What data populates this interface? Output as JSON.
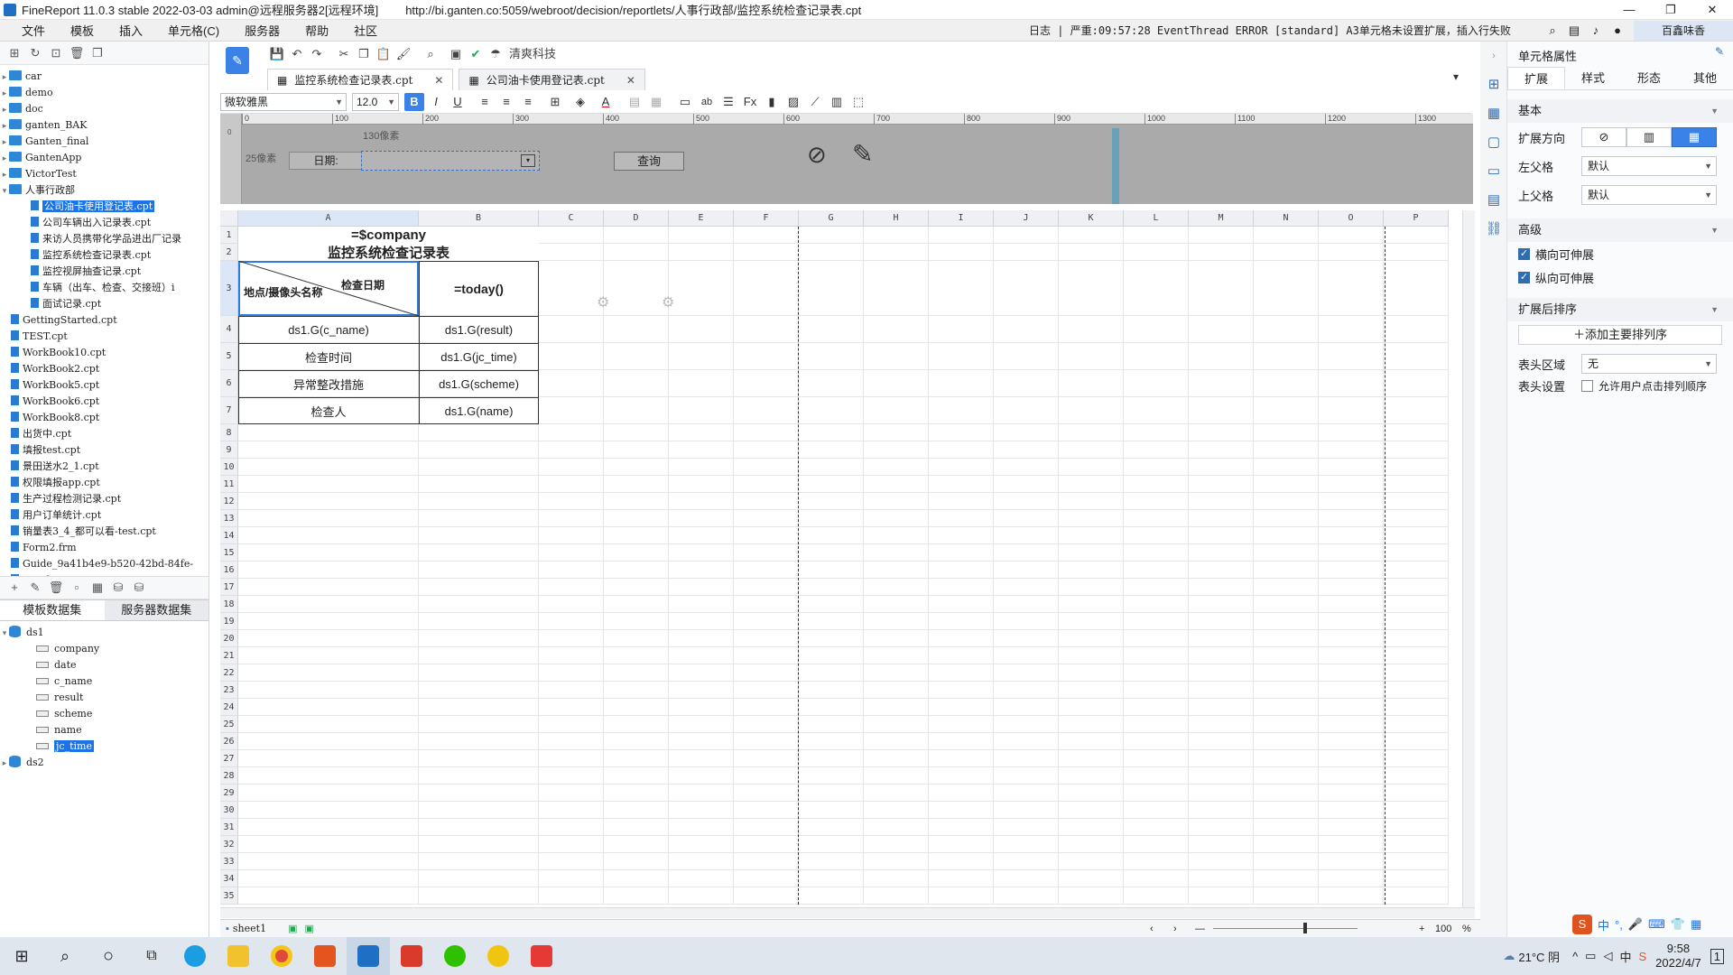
{
  "window": {
    "title": "FineReport 11.0.3 stable 2022-03-03 admin@远程服务器2[远程环境]",
    "url": "http://bi.ganten.co:5059/webroot/decision/reportlets/人事行政部/监控系统检查记录表.cpt",
    "min": "—",
    "restore": "❐",
    "close": "✕"
  },
  "menu": {
    "items": [
      "文件",
      "模板",
      "插入",
      "单元格(C)",
      "服务器",
      "帮助",
      "社区"
    ],
    "log": "日志 | 严重:09:57:28 EventThread ERROR [standard] A3单元格未设置扩展，插入行失败",
    "user": "百鑫味香"
  },
  "tree": [
    {
      "label": "car",
      "type": "folder",
      "level": 0,
      "arrow": "▸"
    },
    {
      "label": "demo",
      "type": "folder",
      "level": 0,
      "arrow": "▸"
    },
    {
      "label": "doc",
      "type": "folder",
      "level": 0,
      "arrow": "▸"
    },
    {
      "label": "ganten_BAK",
      "type": "folder",
      "level": 0,
      "arrow": "▸"
    },
    {
      "label": "Ganten_final",
      "type": "folder",
      "level": 0,
      "arrow": "▸"
    },
    {
      "label": "GantenApp",
      "type": "folder",
      "level": 0,
      "arrow": "▸"
    },
    {
      "label": "VictorTest",
      "type": "folder",
      "level": 0,
      "arrow": "▸"
    },
    {
      "label": "人事行政部",
      "type": "folder",
      "level": 0,
      "arrow": "▾"
    },
    {
      "label": "公司油卡使用登记表.cpt",
      "type": "file",
      "level": 1,
      "selected": true
    },
    {
      "label": "公司车辆出入记录表.cpt",
      "type": "file",
      "level": 1
    },
    {
      "label": "来访人员携带化学品进出厂记录",
      "type": "file",
      "level": 1
    },
    {
      "label": "监控系统检查记录表.cpt",
      "type": "file",
      "level": 1
    },
    {
      "label": "监控视屏抽查记录.cpt",
      "type": "file",
      "level": 1
    },
    {
      "label": "车辆（出车、检查、交接班）i",
      "type": "file",
      "level": 1
    },
    {
      "label": "面试记录.cpt",
      "type": "file",
      "level": 1
    },
    {
      "label": "GettingStarted.cpt",
      "type": "file",
      "level": 0
    },
    {
      "label": "TEST.cpt",
      "type": "file",
      "level": 0
    },
    {
      "label": "WorkBook10.cpt",
      "type": "file",
      "level": 0
    },
    {
      "label": "WorkBook2.cpt",
      "type": "file",
      "level": 0
    },
    {
      "label": "WorkBook5.cpt",
      "type": "file",
      "level": 0
    },
    {
      "label": "WorkBook6.cpt",
      "type": "file",
      "level": 0
    },
    {
      "label": "WorkBook8.cpt",
      "type": "file",
      "level": 0
    },
    {
      "label": "出货中.cpt",
      "type": "file",
      "level": 0
    },
    {
      "label": "填报test.cpt",
      "type": "file",
      "level": 0
    },
    {
      "label": "景田送水2_1.cpt",
      "type": "file",
      "level": 0
    },
    {
      "label": "权限填报app.cpt",
      "type": "file",
      "level": 0
    },
    {
      "label": "生产过程检测记录.cpt",
      "type": "file",
      "level": 0
    },
    {
      "label": "用户订单统计.cpt",
      "type": "file",
      "level": 0
    },
    {
      "label": "销量表3_4_都可以看-test.cpt",
      "type": "file",
      "level": 0
    },
    {
      "label": "Form2.frm",
      "type": "file",
      "level": 0
    },
    {
      "label": "Guide_9a41b4e9-b520-42bd-84fe-",
      "type": "file",
      "level": 0
    },
    {
      "label": "test.frm",
      "type": "file",
      "level": 0
    }
  ],
  "datasets": {
    "tab_template": "模板数据集",
    "tab_server": "服务器数据集",
    "ds1": "ds1",
    "fields": [
      "company",
      "date",
      "c_name",
      "result",
      "scheme",
      "name",
      "jc_time"
    ],
    "ds2": "ds2"
  },
  "doctabs": [
    {
      "label": "监控系统检查记录表.cpt",
      "close": "✕"
    },
    {
      "label": "公司油卡使用登记表.cpt",
      "close": "✕"
    }
  ],
  "toolbar": {
    "brand": "清爽科技"
  },
  "format": {
    "font": "微软雅黑",
    "size": "12.0",
    "bold": "B",
    "italic": "I",
    "underline": "U",
    "ab": "ab"
  },
  "param": {
    "width_hint": "130像素",
    "height_hint": "25像素",
    "date_label": "日期:",
    "query": "查询"
  },
  "ruler": [
    "0",
    "100",
    "200",
    "300",
    "400",
    "500",
    "600",
    "700",
    "800",
    "900",
    "1000",
    "1100",
    "1200",
    "1300"
  ],
  "columns": [
    "A",
    "B",
    "C",
    "D",
    "E",
    "F",
    "G",
    "H",
    "I",
    "J",
    "K",
    "L",
    "M",
    "N",
    "O",
    "P"
  ],
  "rows": [
    "1",
    "2",
    "3",
    "4",
    "5",
    "6",
    "7",
    "8",
    "9",
    "10",
    "11",
    "12",
    "13",
    "14",
    "15",
    "16",
    "17",
    "18",
    "19",
    "20",
    "21",
    "22",
    "23",
    "24",
    "25",
    "26",
    "27",
    "28",
    "29",
    "30",
    "31",
    "32",
    "33",
    "34",
    "35"
  ],
  "cells": {
    "a1": "=$company",
    "a2": "监控系统检查记录表",
    "a3_top": "检查日期",
    "a3_bottom": "地点/摄像头名称",
    "b3": "=today()",
    "a4": "ds1.G(c_name)",
    "b4": "ds1.G(result)",
    "a5": "检查时间",
    "b5": "ds1.G(jc_time)",
    "a6": "异常整改措施",
    "b6": "ds1.G(scheme)",
    "a7": "检查人",
    "b7": "ds1.G(name)"
  },
  "sheet": {
    "tab": "sheet1",
    "zoom": "100",
    "pct": "%"
  },
  "props": {
    "title": "单元格属性",
    "tabs": [
      "扩展",
      "样式",
      "形态",
      "其他"
    ],
    "basic": "基本",
    "expand_dir": "扩展方向",
    "left_parent": "左父格",
    "left_parent_val": "默认",
    "top_parent": "上父格",
    "top_parent_val": "默认",
    "advanced": "高级",
    "h_stretch": "横向可伸展",
    "v_stretch": "纵向可伸展",
    "sort": "扩展后排序",
    "add_sort": "添加主要排列序",
    "header_area": "表头区域",
    "header_area_val": "无",
    "header_set": "表头设置",
    "allow_click": "允许用户点击排列顺序"
  },
  "tray": {
    "weather": "21°C 阴",
    "ime": "中",
    "time": "9:58",
    "date": "2022/4/7",
    "notif": "1"
  }
}
